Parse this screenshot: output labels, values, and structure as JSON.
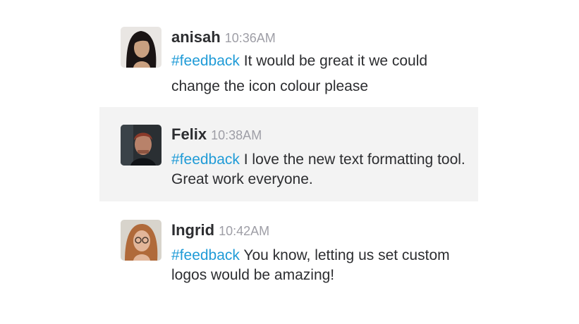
{
  "messages": [
    {
      "author": "anisah",
      "time": "10:36AM",
      "hashtag": "#feedback",
      "text": "It would be great it we could change the icon colour please"
    },
    {
      "author": "Felix",
      "time": "10:38AM",
      "hashtag": "#feedback",
      "text": "I love the new text formatting tool. Great work everyone."
    },
    {
      "author": "Ingrid",
      "time": "10:42AM",
      "hashtag": "#feedback",
      "text": "You know, letting us set custom logos would be amazing!"
    }
  ],
  "colors": {
    "hashtag": "#1f9bd7",
    "timestamp": "#9e9ea6",
    "highlight_bg": "#f3f3f3",
    "text": "#2c2d30"
  }
}
